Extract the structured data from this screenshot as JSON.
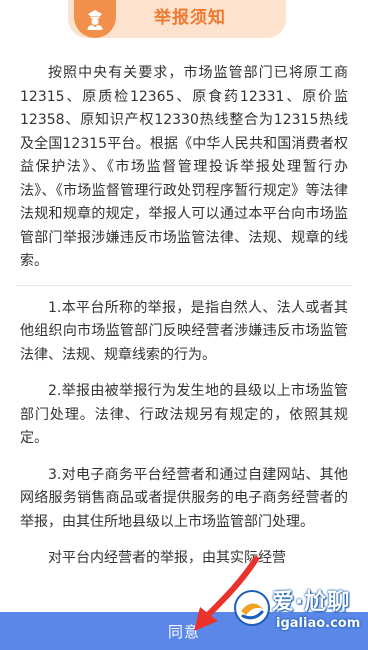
{
  "header": {
    "icon": "police-officer-icon",
    "title": "举报须知"
  },
  "content": {
    "intro": "按照中央有关要求，市场监管部门已将原工商12315、原质检12365、原食药12331、原价监12358、原知识产权12330热线整合为12315热线及全国12315平台。根据《中华人民共和国消费者权益保护法》、《市场监督管理投诉举报处理暂行办法》、《市场监督管理行政处罚程序暂行规定》等法律法规和规章的规定，举报人可以通过本平台向市场监管部门举报涉嫌违反市场监管法律、法规、规章的线索。",
    "item1": "1.本平台所称的举报，是指自然人、法人或者其他组织向市场监管部门反映经营者涉嫌违反市场监管法律、法规、规章线索的行为。",
    "item2": "2.举报由被举报行为发生地的县级以上市场监管部门处理。法律、行政法规另有规定的，依照其规定。",
    "item3": "3.对电子商务平台经营者和通过自建网站、其他网络服务销售商品或者提供服务的电子商务经营者的举报，由其住所地县级以上市场监管部门处理。",
    "item4": "对平台内经营者的举报，由其实际经营"
  },
  "footer": {
    "agree_label": "同意"
  },
  "watermark": {
    "text": "爱·尬聊",
    "url": "igaliao.com"
  },
  "colors": {
    "accent": "#ee7a32",
    "header_bg": "#fde2cd",
    "button_bg": "#5a87e8"
  }
}
